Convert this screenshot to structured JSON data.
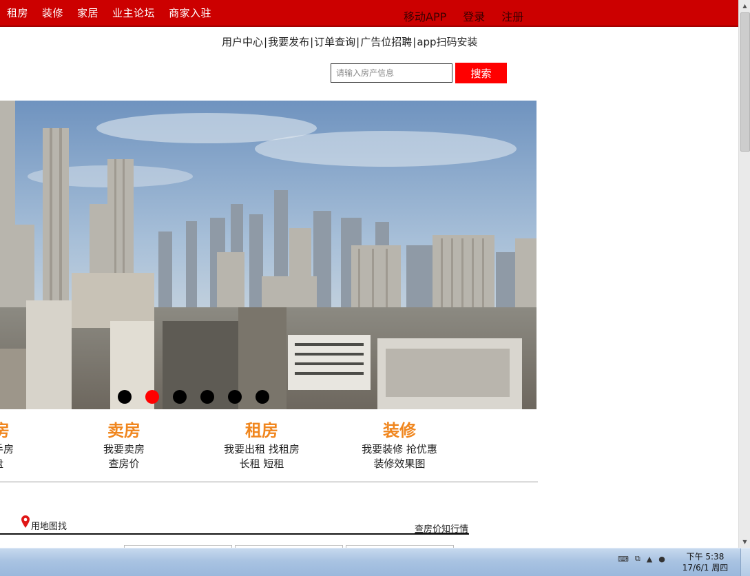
{
  "topnav": {
    "left_items": [
      "租房",
      "装修",
      "家居",
      "业主论坛",
      "商家入驻"
    ],
    "right_items": [
      "移动APP",
      "登录",
      "注册"
    ]
  },
  "util_links": [
    "用户中心",
    "我要发布",
    "订单查询",
    "广告位招聘",
    "app扫码安装"
  ],
  "search": {
    "placeholder": "请输入房产信息",
    "button": "搜索"
  },
  "carousel": {
    "slide_count": 6,
    "active_index": 1
  },
  "categories": [
    {
      "title": "房",
      "lines": [
        "手房",
        "盘"
      ]
    },
    {
      "title": "卖房",
      "lines": [
        "我要卖房",
        "查房价"
      ]
    },
    {
      "title": "租房",
      "lines": [
        "我要出租 找租房",
        "长租 短租"
      ]
    },
    {
      "title": "装修",
      "lines": [
        "我要装修 抢优惠",
        "装修效果图"
      ]
    }
  ],
  "map_link": "用地图找",
  "price_link": "查房价知行情",
  "colors": {
    "topbar": "#cc0000",
    "search_button": "#ff0000",
    "category_title": "#f0861e",
    "active_dot": "#ff0000"
  },
  "taskbar": {
    "time": "下午 5:38",
    "date": "17/6/1 周四"
  }
}
